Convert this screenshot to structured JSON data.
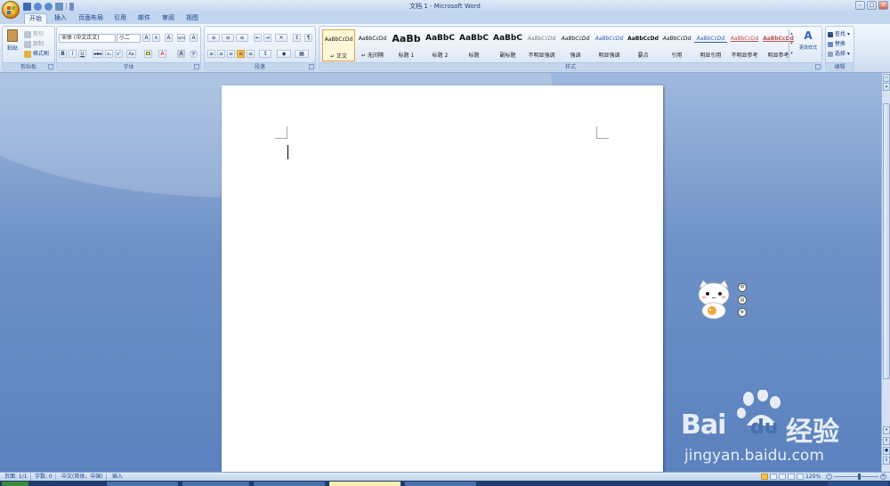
{
  "window": {
    "title": "文档 1 - Microsoft Word"
  },
  "tabs": [
    {
      "label": "开始",
      "active": true
    },
    {
      "label": "插入"
    },
    {
      "label": "页面布局"
    },
    {
      "label": "引用"
    },
    {
      "label": "邮件"
    },
    {
      "label": "审阅"
    },
    {
      "label": "视图"
    }
  ],
  "clipboard": {
    "label": "剪贴板",
    "paste_label": "粘贴",
    "cut_label": "剪切",
    "copy_label": "复制",
    "format_painter_label": "格式刷"
  },
  "font": {
    "label": "字体",
    "font_name": "宋体 (中文正文)",
    "font_size": "小二",
    "bold": "B",
    "italic": "I",
    "underline": "U",
    "strike": "abc",
    "subscript": "x₂",
    "superscript": "x²",
    "case": "Aa",
    "grow": "A",
    "shrink": "A",
    "clear": "A",
    "font_color": "A",
    "char_border": "A",
    "encircle": "字",
    "phonetic": "wén",
    "shading": "A"
  },
  "paragraph": {
    "label": "段落"
  },
  "styles": {
    "label": "样式",
    "items": [
      {
        "preview": "AaBbCcDd",
        "name": "↵ 正文",
        "active": true
      },
      {
        "preview": "AaBbCcDd",
        "name": "↵ 无间隔"
      },
      {
        "preview": "AaBb",
        "name": "标题 1"
      },
      {
        "preview": "AaBbC",
        "name": "标题 2"
      },
      {
        "preview": "AaBbC",
        "name": "标题"
      },
      {
        "preview": "AaBbC",
        "name": "副标题"
      },
      {
        "preview": "AaBbCcDd",
        "name": "不明显强调"
      },
      {
        "preview": "AaBbCcDd",
        "name": "强调"
      },
      {
        "preview": "AaBbCcDd",
        "name": "明显强调"
      },
      {
        "preview": "AaBbCcDd",
        "name": "要点"
      },
      {
        "preview": "AaBbCcDd",
        "name": "引用"
      },
      {
        "preview": "AaBbCcDd",
        "name": "明显引用"
      },
      {
        "preview": "AaBbCcDd",
        "name": "不明显参考"
      },
      {
        "preview": "AaBbCcDd",
        "name": "明显参考"
      }
    ],
    "change_styles_label": "更改样式"
  },
  "editing": {
    "label": "编辑",
    "find_label": "查找 ▾",
    "replace_label": "替换",
    "select_label": "选择 ▾"
  },
  "status": {
    "page": "页面: 1/1",
    "words": "字数: 0",
    "language": "中文(简体，中国)",
    "mode": "插入",
    "zoom": "120%"
  },
  "watermark": {
    "brand_top": "Bai",
    "brand_mid": "du",
    "brand_cn": "经验",
    "url": "jingyan.baidu.com"
  },
  "colors": {
    "accent": "#15428b",
    "ribbon_bg": "#dde8f6",
    "workspace": "#6d90c6",
    "highlight": "#ffff00",
    "font_color": "#ff0000"
  }
}
